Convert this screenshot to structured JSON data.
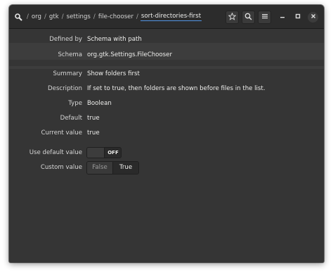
{
  "header": {
    "path_icon": "dconf-logo-icon",
    "path": [
      {
        "label": "org"
      },
      {
        "label": "gtk"
      },
      {
        "label": "settings"
      },
      {
        "label": "file-chooser"
      },
      {
        "label": "sort-directories-first"
      }
    ],
    "separator": "/",
    "buttons": [
      "bookmark-star-icon",
      "search-icon",
      "hamburger-menu-icon"
    ],
    "window_controls": [
      "minimize-icon",
      "maximize-icon",
      "close-icon"
    ]
  },
  "key": {
    "defined_by": {
      "label": "Defined by",
      "value": "Schema with path"
    },
    "schema": {
      "label": "Schema",
      "value": "org.gtk.Settings.FileChooser"
    },
    "summary": {
      "label": "Summary",
      "value": "Show folders first"
    },
    "description": {
      "label": "Description",
      "value": "If set to true, then folders are shown before files in the list."
    },
    "type": {
      "label": "Type",
      "value": "Boolean"
    },
    "default": {
      "label": "Default",
      "value": "true"
    },
    "current_value": {
      "label": "Current value",
      "value": "true"
    },
    "use_default": {
      "label": "Use default value",
      "state": "OFF"
    },
    "custom_value": {
      "label": "Custom value",
      "options": [
        "False",
        "True"
      ],
      "selected": "True"
    }
  },
  "colors": {
    "accent": "#5294e2",
    "window_bg": "#353535",
    "header_bg": "#2c2c2c"
  }
}
